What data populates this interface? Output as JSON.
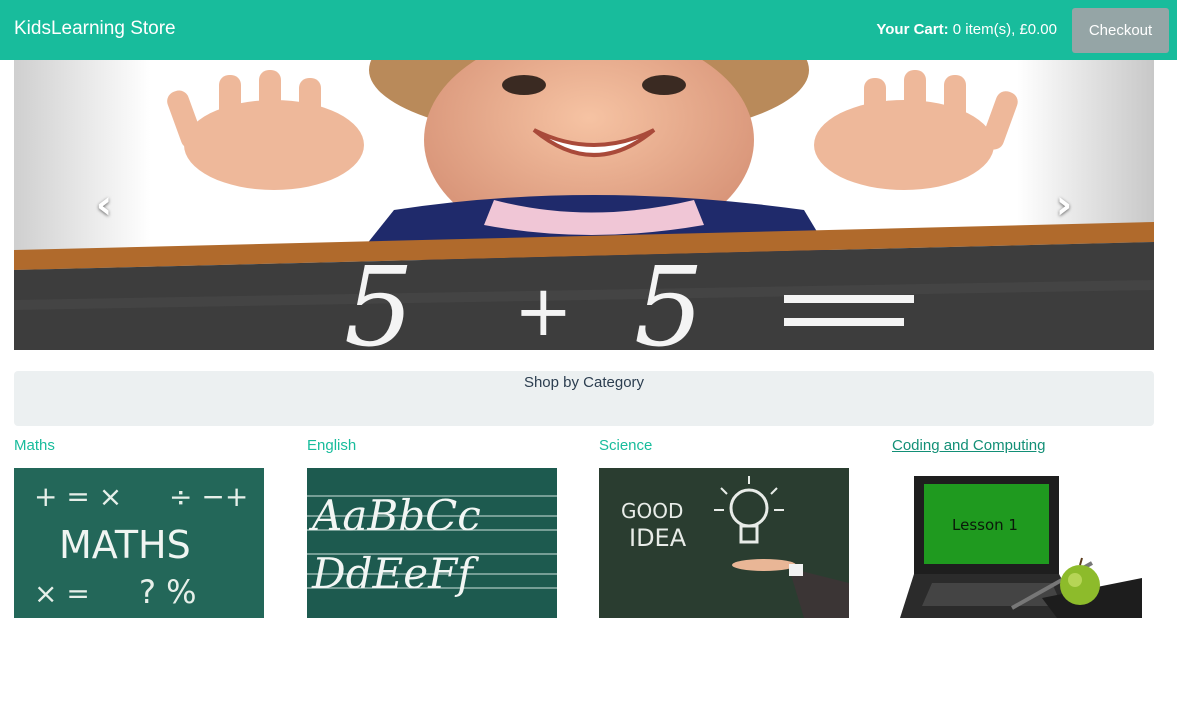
{
  "navbar": {
    "brand": "KidsLearning Store",
    "cart_label": "Your Cart:",
    "cart_value": "0 item(s), £0.00",
    "checkout_label": "Checkout"
  },
  "carousel": {
    "prev_icon": "chevron-left-icon",
    "next_icon": "chevron-right-icon"
  },
  "categories_heading": "Shop by Category",
  "categories": [
    {
      "label": "Maths"
    },
    {
      "label": "English"
    },
    {
      "label": "Science"
    },
    {
      "label": "Coding and Computing"
    }
  ],
  "colors": {
    "navbar": "#18bc9c",
    "checkout_button": "#95a5a6",
    "link": "#18bc9c",
    "well": "#ecf0f1"
  }
}
